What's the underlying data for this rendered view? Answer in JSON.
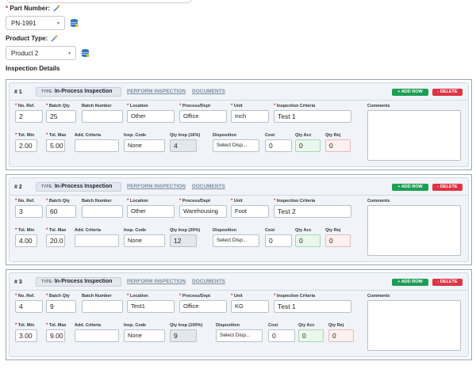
{
  "header": {
    "part_number_label": "Part Number:",
    "part_number_value": "PN-1991",
    "product_type_label": "Product Type:",
    "product_type_value": "Product 2",
    "section_title": "Inspection Details"
  },
  "colors": {
    "add": "#1f9d55",
    "delete": "#dc3545",
    "required": "#d9302a"
  },
  "labels": {
    "type_prefix": "TYPE:",
    "perform": "PERFORM INSPECTION",
    "documents": "DOCUMENTS",
    "add_row": "+ ADD ROW",
    "delete": "- DELETE",
    "no_ref": "No. Ref.",
    "batch_qty": "Batch Qty",
    "batch_number": "Batch Number",
    "location": "Location",
    "process_dept": "Process/Dept",
    "unit": "Unit",
    "inspection_criteria": "Inspection Criteria",
    "comments": "Comments",
    "tol_min": "Tol. Min",
    "tol_max": "Tol. Max",
    "add_criteria": "Add. Criteria",
    "insp_code": "Insp. Code",
    "disposition": "Disposition",
    "cost": "Cost",
    "qty_acc": "Qty Acc",
    "qty_rej": "Qty Rej"
  },
  "rows": [
    {
      "num": "# 1",
      "type": "In-Process Inspection",
      "no_ref": "2",
      "batch_qty": "25",
      "batch_number": "",
      "location": "Other",
      "process": "Office",
      "unit": "Inch",
      "criteria": "Test 1",
      "tol_min": "2.00",
      "tol_max": "5.00",
      "add_criteria": "",
      "insp_code": "None",
      "qty_insp_label": "Qty Insp (16%)",
      "qty_insp": "4",
      "disposition": "Select Disp...",
      "cost": "0",
      "qty_acc": "0",
      "qty_rej": "0"
    },
    {
      "num": "# 2",
      "type": "In-Process Inspection",
      "no_ref": "3",
      "batch_qty": "60",
      "batch_number": "",
      "location": "Other",
      "process": "Warehousing",
      "unit": "Foot",
      "criteria": "Test 2",
      "tol_min": "4.00",
      "tol_max": "20.0",
      "add_criteria": "",
      "insp_code": "None",
      "qty_insp_label": "Qty Insp (20%)",
      "qty_insp": "12",
      "disposition": "Select Disp...",
      "cost": "0",
      "qty_acc": "0",
      "qty_rej": "0"
    },
    {
      "num": "# 3",
      "type": "In-Process Inspection",
      "no_ref": "4",
      "batch_qty": "9",
      "batch_number": "",
      "location": "Test1",
      "process": "Office",
      "unit": "KG",
      "criteria": "Test 1",
      "tol_min": "3.00",
      "tol_max": "9.00",
      "add_criteria": "",
      "insp_code": "None",
      "qty_insp_label": "Qty Insp (100%)",
      "qty_insp": "9",
      "disposition": "Select Disp...",
      "cost": "0",
      "qty_acc": "0",
      "qty_rej": "0"
    }
  ]
}
